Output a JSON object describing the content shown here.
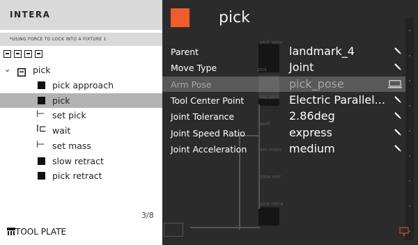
{
  "app": {
    "title": "INTERA"
  },
  "task": {
    "description": "*USING FORCE TO LOCK INTO A FIXTURE 1"
  },
  "tray_icons": [
    "block-icon",
    "block-icon",
    "loop-icon",
    "block-icon"
  ],
  "tree": {
    "parent": {
      "label": "pick",
      "icon": "block-icon",
      "expanded": true
    },
    "items": [
      {
        "label": "pick approach",
        "icon": "square-icon",
        "selected": false
      },
      {
        "label": "pick",
        "icon": "square-icon",
        "selected": true
      },
      {
        "label": "set pick",
        "icon": "set-icon",
        "selected": false
      },
      {
        "label": "wait",
        "icon": "wait-icon",
        "selected": false
      },
      {
        "label": "set mass",
        "icon": "set-icon",
        "selected": false
      },
      {
        "label": "slow retract",
        "icon": "square-icon",
        "selected": false
      },
      {
        "label": "pick retract",
        "icon": "square-icon",
        "selected": false
      }
    ]
  },
  "pager": "3/8",
  "footer": {
    "label": "TOOL PLATE"
  },
  "panel": {
    "title": "pick",
    "accent_color": "#f25c2d",
    "properties": [
      {
        "key": "Parent",
        "value": "landmark_4",
        "enabled": true,
        "icon": "edit-icon"
      },
      {
        "key": "Move Type",
        "value": "Joint",
        "enabled": true,
        "icon": "edit-icon"
      },
      {
        "key": "Arm Pose",
        "value": "pick_pose",
        "enabled": false,
        "icon": "screen-icon"
      },
      {
        "key": "Tool Center Point",
        "value": "Electric Parallel...",
        "enabled": true,
        "icon": "edit-icon"
      },
      {
        "key": "Joint Tolerance",
        "value": "2.86deg",
        "enabled": true,
        "icon": "edit-icon"
      },
      {
        "key": "Joint Speed Ratio",
        "value": "express",
        "enabled": true,
        "icon": "edit-icon"
      },
      {
        "key": "Joint Acceleration",
        "value": "medium",
        "enabled": true,
        "icon": "edit-icon"
      }
    ]
  },
  "background_labels": [
    "pick appr",
    "pick",
    "set pick",
    "wait",
    "set mass",
    "slow retr",
    "pick retra"
  ]
}
